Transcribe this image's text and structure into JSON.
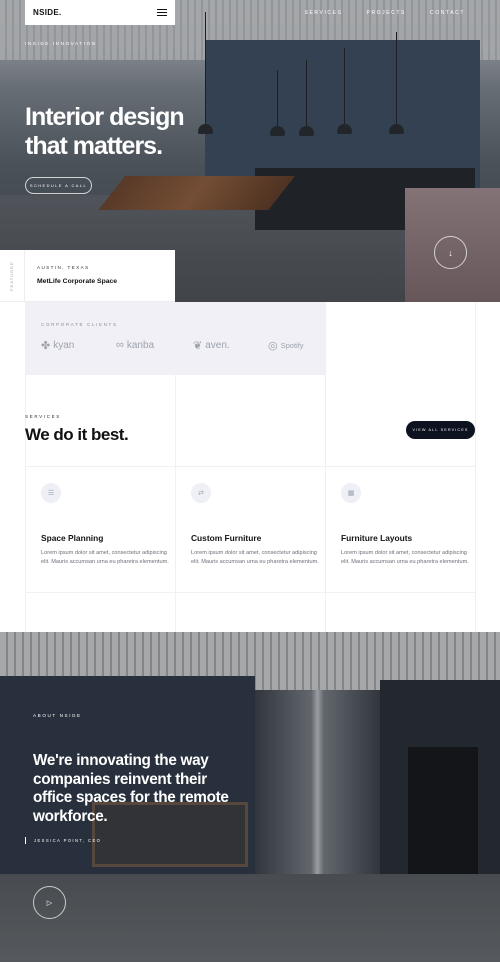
{
  "header": {
    "logo": "NSIDE.",
    "menu_icon": "hamburger-menu-icon",
    "nav": [
      "SERVICES",
      "PROJECTS",
      "CONTACT"
    ]
  },
  "hero": {
    "eyebrow": "INSIDE INNOVATION",
    "title_line1": "Interior design",
    "title_line2": "that matters.",
    "cta": "SCHEDULE A CALL",
    "scroll_icon": "arrow-down-icon"
  },
  "featured": {
    "side_label": "FEATURED",
    "location": "AUSTIN, TEXAS",
    "project": "MetLife Corporate Space"
  },
  "clients": {
    "label": "CORPORATE CLIENTS",
    "logos": [
      {
        "name": "kyan",
        "icon": "kyan-logo-icon"
      },
      {
        "name": "kanba",
        "icon": "kanba-logo-icon"
      },
      {
        "name": "aven.",
        "icon": "aven-logo-icon"
      },
      {
        "name": "Spotify",
        "icon": "spotify-logo-icon"
      }
    ]
  },
  "services": {
    "eyebrow": "SERVICES",
    "title": "We do it best.",
    "button": "VIEW ALL SERVICES",
    "cards": [
      {
        "title": "Space Planning",
        "text": "Lorem ipsum dolor sit amet, consectetur adipiscing elit. Mauris accumsan urna eu pharetra elementum.",
        "icon": "space-planning-icon"
      },
      {
        "title": "Custom Furniture",
        "text": "Lorem ipsum dolor sit amet, consectetur adipiscing elit. Mauris accumsan urna eu pharetra elementum.",
        "icon": "custom-furniture-icon"
      },
      {
        "title": "Furniture Layouts",
        "text": "Lorem ipsum dolor sit amet, consectetur adipiscing elit. Mauris accumsan urna eu pharetra elementum.",
        "icon": "furniture-layouts-icon"
      }
    ]
  },
  "about": {
    "eyebrow": "ABOUT NSIDE",
    "quote": "We're innovating the way companies reinvent their office spaces for the remote workforce.",
    "author": "JESSICA POINT, CEO",
    "play_icon": "play-icon"
  }
}
